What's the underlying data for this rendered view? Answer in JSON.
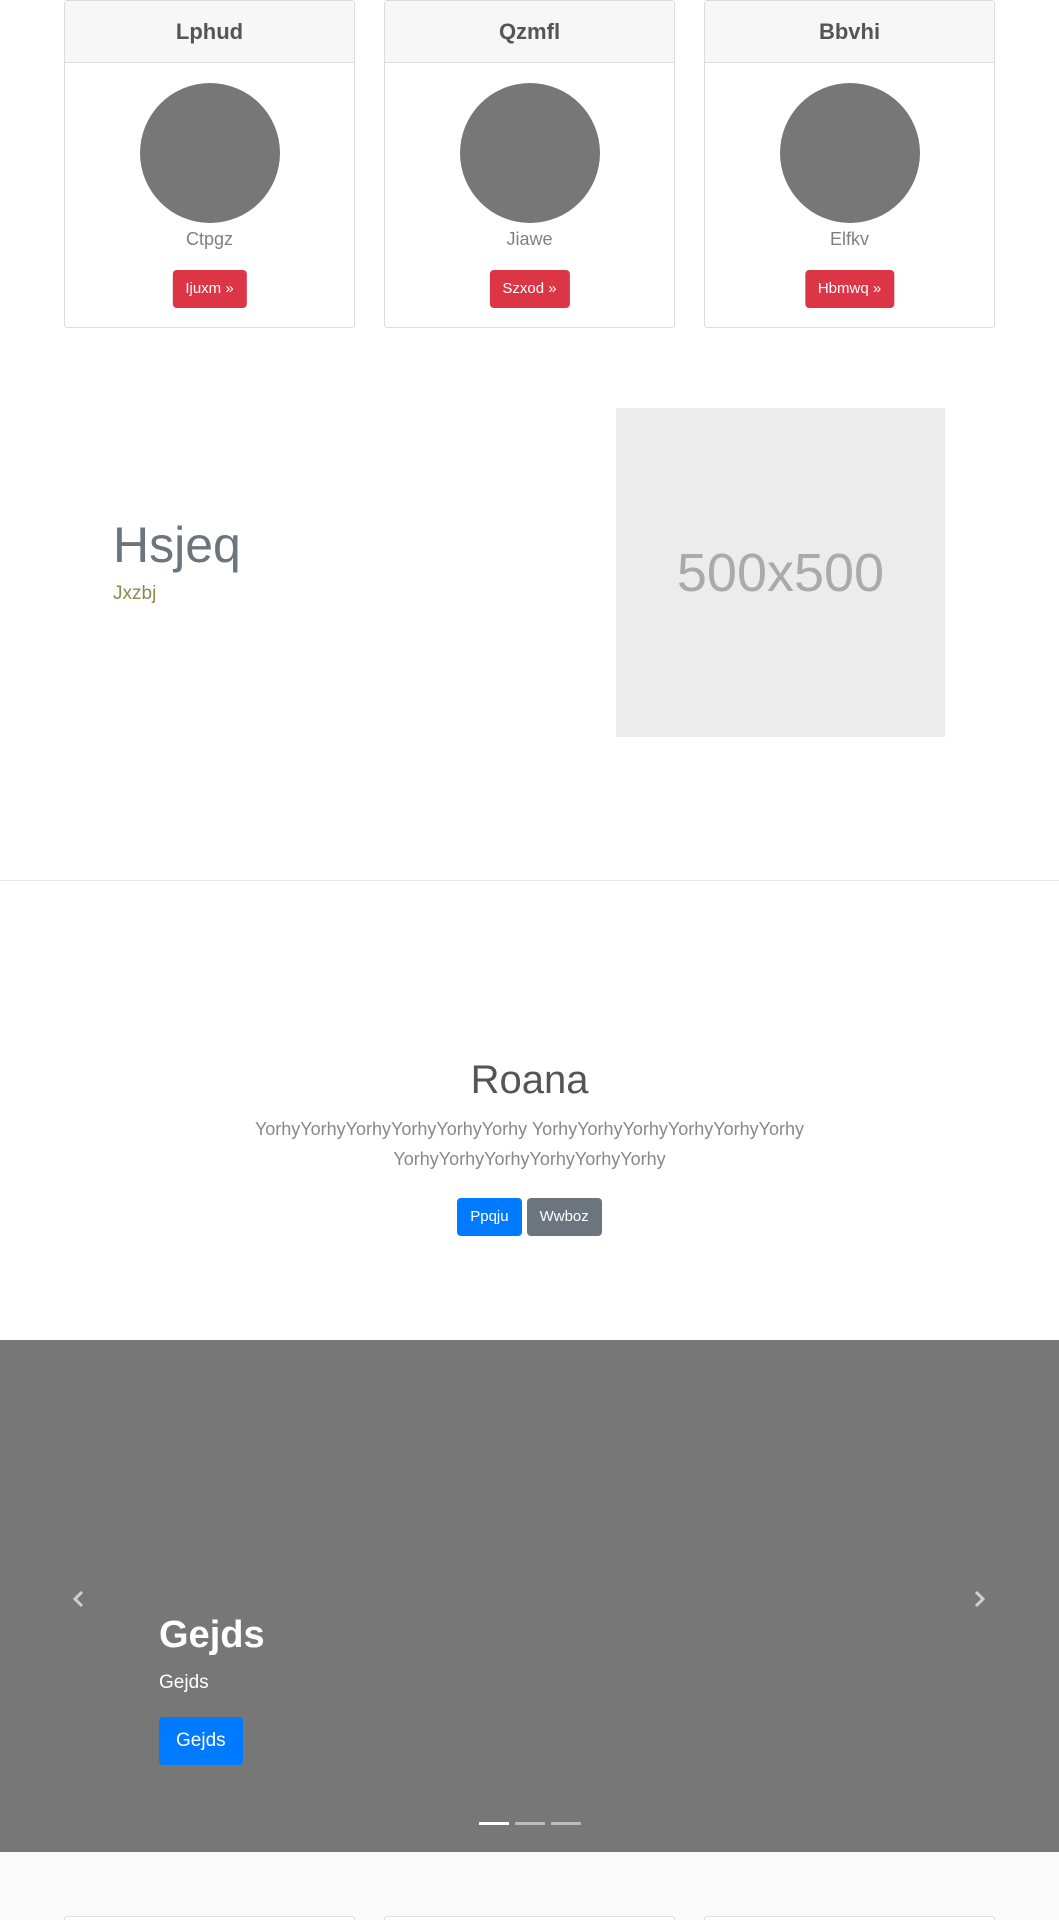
{
  "cards": [
    {
      "title": "Lphud",
      "subtitle": "Ctpgz",
      "button": "Ijuxm »"
    },
    {
      "title": "Qzmfl",
      "subtitle": "Jiawe",
      "button": "Szxod »"
    },
    {
      "title": "Bbvhi",
      "subtitle": "Elfkv",
      "button": "Hbmwq »"
    }
  ],
  "feature": {
    "title": "Hsjeq",
    "subtitle": "Jxzbj",
    "image_placeholder": "500x500"
  },
  "hero": {
    "title": "Roana",
    "text": "YorhyYorhyYorhyYorhyYorhyYorhy YorhyYorhyYorhyYorhyYorhyYorhy YorhyYorhyYorhyYorhyYorhyYorhy",
    "primary_button": "Ppqju",
    "secondary_button": "Wwboz"
  },
  "carousel": {
    "caption_title": "Gejds",
    "caption_text": "Gejds",
    "caption_button": "Gejds",
    "prev_icon": "chevron-left-icon",
    "next_icon": "chevron-right-icon",
    "indicators": 3,
    "active_index": 0
  },
  "colors": {
    "danger": "#dc3545",
    "primary": "#007bff",
    "secondary": "#6c757d",
    "carousel_bg": "#777777"
  }
}
